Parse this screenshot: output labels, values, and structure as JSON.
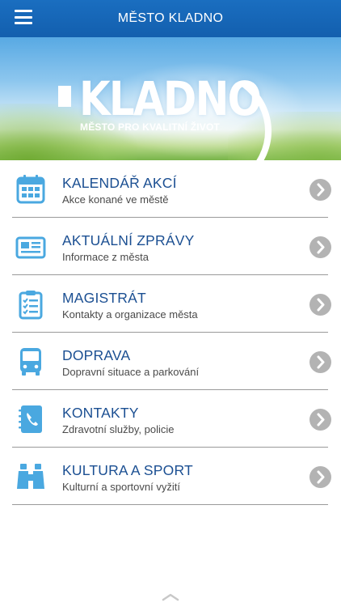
{
  "header": {
    "title": "MĚSTO KLADNO",
    "menu_icon": "hamburger-menu-icon"
  },
  "banner": {
    "logo_text": "KLADNO",
    "logo_tagline": "MĚSTO PRO KVALITNÍ ŽIVOT"
  },
  "menu": {
    "items": [
      {
        "title": "KALENDÁŘ AKCÍ",
        "subtitle": "Akce konané ve městě",
        "icon": "calendar-icon"
      },
      {
        "title": "AKTUÁLNÍ ZPRÁVY",
        "subtitle": "Informace z města",
        "icon": "newspaper-icon"
      },
      {
        "title": "MAGISTRÁT",
        "subtitle": "Kontakty a organizace města",
        "icon": "clipboard-checklist-icon"
      },
      {
        "title": "DOPRAVA",
        "subtitle": "Dopravní situace a parkování",
        "icon": "bus-icon"
      },
      {
        "title": "KONTAKTY",
        "subtitle": "Zdravotní služby, policie",
        "icon": "phone-book-icon"
      },
      {
        "title": "KULTURA A SPORT",
        "subtitle": "Kulturní a sportovní vyžití",
        "icon": "binoculars-icon"
      }
    ]
  },
  "colors": {
    "header_bg": "#135fae",
    "title_text": "#1b4f92",
    "icon_blue": "#4aa8e0",
    "chevron_bg": "#b3b3b3"
  }
}
